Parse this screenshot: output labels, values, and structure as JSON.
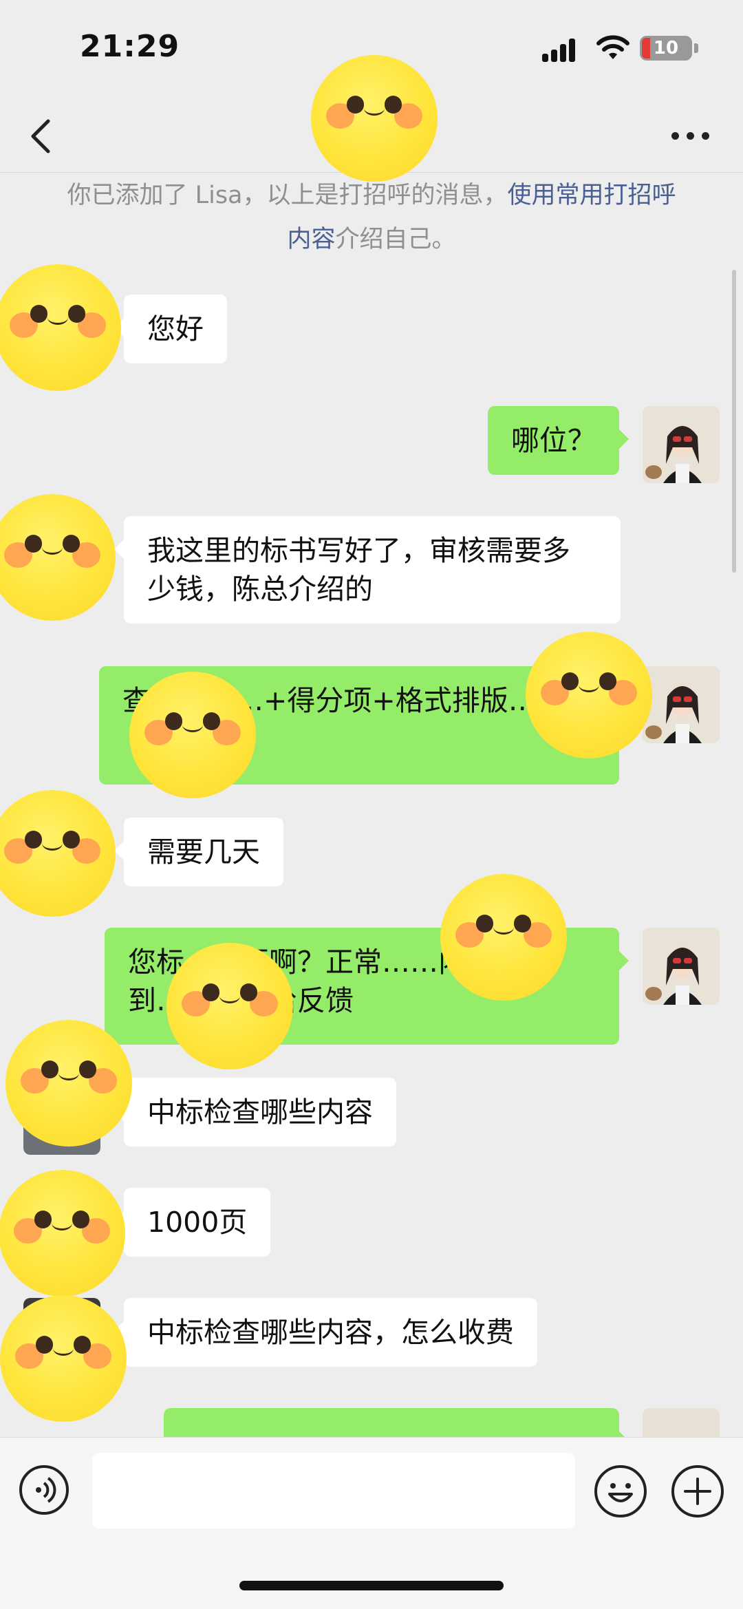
{
  "status_bar": {
    "time": "21:29",
    "battery": "10"
  },
  "nav": {
    "back_icon": "chevron-left-icon",
    "more_icon": "ellipsis-icon"
  },
  "notice": {
    "text_before": "你已添加了 Lisa，以上是打招呼的消息，",
    "link": "使用常用打招呼内容",
    "text_after": "介绍自己。"
  },
  "messages": [
    {
      "side": "in",
      "text": "您好"
    },
    {
      "side": "out",
      "text": "哪位？"
    },
    {
      "side": "in",
      "text": "我这里的标书写好了，审核需要多少钱，陈总介绍的"
    },
    {
      "side": "out",
      "text": "查…………+得分项+格式排版……"
    },
    {
      "side": "in",
      "text": "需要几天"
    },
    {
      "side": "out",
      "text": "您标……页啊？正常……内，收到……时内给反馈"
    },
    {
      "side": "in",
      "text": "中标检查哪些内容"
    },
    {
      "side": "in",
      "text": "1000页"
    },
    {
      "side": "in",
      "text": "中标检查哪些内容，怎么收费"
    },
    {
      "side": "out",
      "text": ""
    }
  ],
  "input_bar": {
    "voice_icon": "voice-icon",
    "emoji_icon": "emoji-icon",
    "plus_icon": "plus-icon",
    "placeholder": ""
  }
}
